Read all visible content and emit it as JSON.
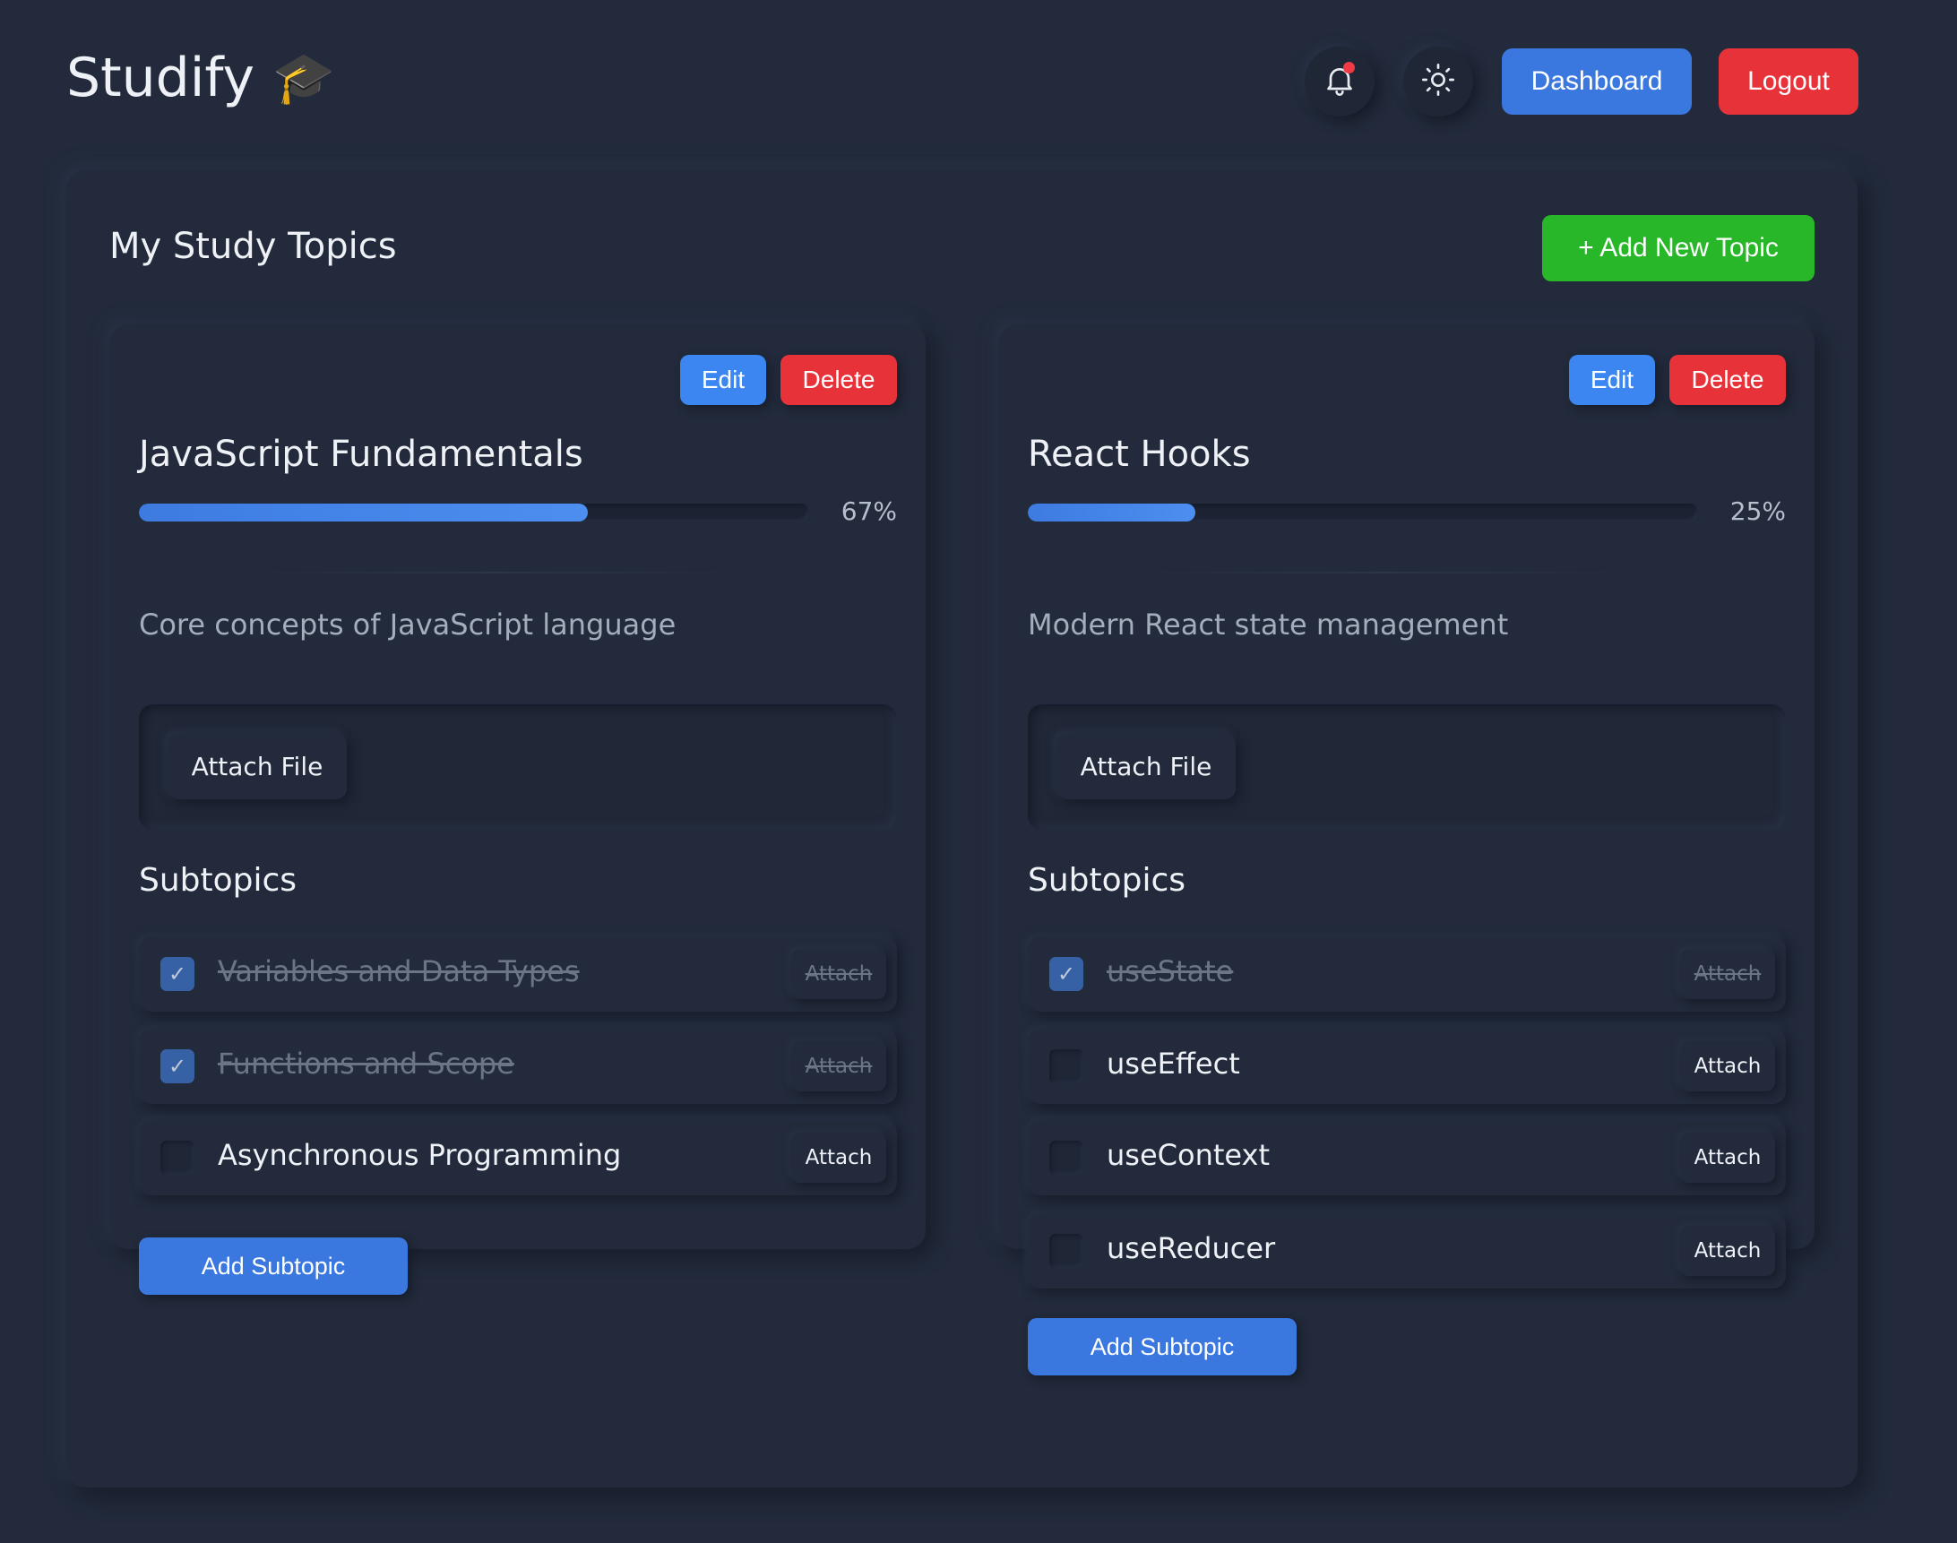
{
  "app": {
    "name": "Studify",
    "logo_icon": "🎓"
  },
  "header": {
    "notification_icon": "bell-icon",
    "theme_icon": "sun-icon",
    "dashboard_label": "Dashboard",
    "logout_label": "Logout"
  },
  "panel": {
    "title": "My Study Topics",
    "add_topic_label": "+ Add New Topic"
  },
  "topics": [
    {
      "edit_label": "Edit",
      "delete_label": "Delete",
      "title": "JavaScript Fundamentals",
      "progress": 67,
      "progress_label": "67%",
      "description": "Core concepts of JavaScript language",
      "attach_file_label": "Attach File",
      "subtopics_heading": "Subtopics",
      "subtopics": [
        {
          "label": "Variables and Data Types",
          "done": true,
          "attach_label": "Attach"
        },
        {
          "label": "Functions and Scope",
          "done": true,
          "attach_label": "Attach"
        },
        {
          "label": "Asynchronous Programming",
          "done": false,
          "attach_label": "Attach"
        }
      ],
      "add_subtopic_label": "Add Subtopic"
    },
    {
      "edit_label": "Edit",
      "delete_label": "Delete",
      "title": "React Hooks",
      "progress": 25,
      "progress_label": "25%",
      "description": "Modern React state management",
      "attach_file_label": "Attach File",
      "subtopics_heading": "Subtopics",
      "subtopics": [
        {
          "label": "useState",
          "done": true,
          "attach_label": "Attach"
        },
        {
          "label": "useEffect",
          "done": false,
          "attach_label": "Attach"
        },
        {
          "label": "useContext",
          "done": false,
          "attach_label": "Attach"
        },
        {
          "label": "useReducer",
          "done": false,
          "attach_label": "Attach"
        }
      ],
      "add_subtopic_label": "Add Subtopic"
    }
  ]
}
